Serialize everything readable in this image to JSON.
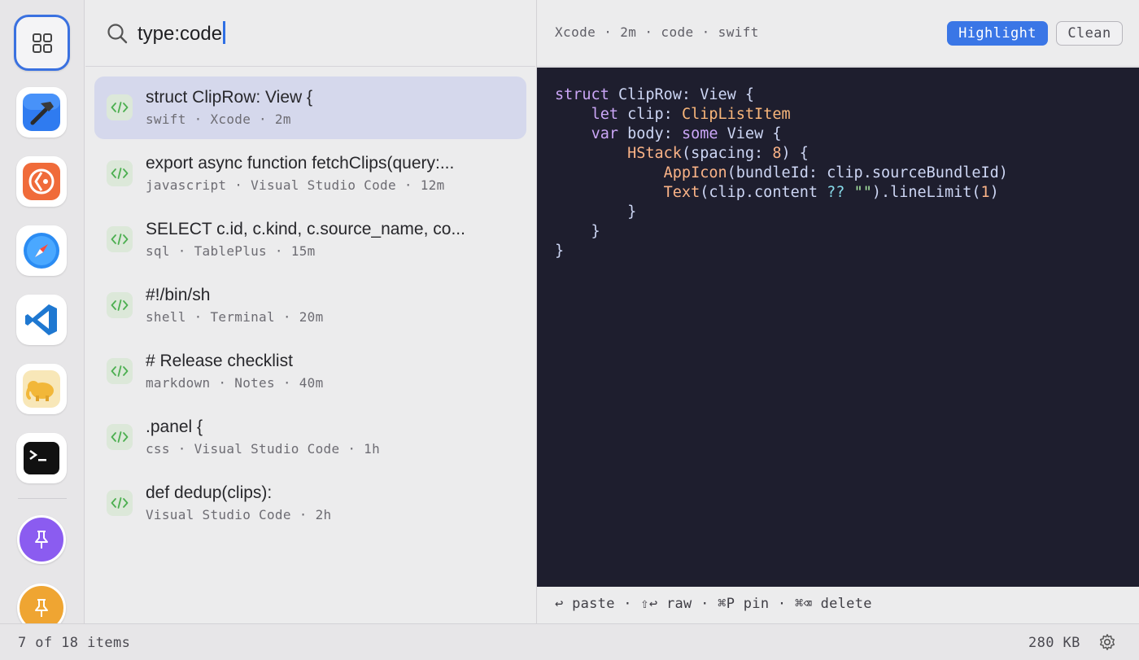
{
  "rail": {
    "items": [
      {
        "id": "all",
        "icon": "grid-icon",
        "selected": true
      },
      {
        "id": "xcode",
        "icon": "xcode-hammer-icon",
        "color": "#2f7bf0"
      },
      {
        "id": "git",
        "icon": "git-app-icon",
        "color": "#f06b3a"
      },
      {
        "id": "safari",
        "icon": "safari-compass-icon",
        "color": "#2b8cf3"
      },
      {
        "id": "vscode",
        "icon": "vscode-icon",
        "color": "#1f78d1"
      },
      {
        "id": "tableplus",
        "icon": "elephant-icon",
        "color": "#f2b739"
      },
      {
        "id": "terminal",
        "icon": "terminal-icon",
        "color": "#111111"
      }
    ],
    "pins": [
      {
        "icon": "pin-icon",
        "color": "#8b5cf0"
      },
      {
        "icon": "pin-icon",
        "color": "#efa532"
      }
    ]
  },
  "search": {
    "query": "type:code"
  },
  "clips": [
    {
      "title": "struct ClipRow: View {",
      "meta": "swift · Xcode · 2m",
      "selected": true
    },
    {
      "title": "export async function fetchClips(query:...",
      "meta": "javascript · Visual Studio Code · 12m"
    },
    {
      "title": "SELECT c.id, c.kind, c.source_name, co...",
      "meta": "sql · TablePlus · 15m"
    },
    {
      "title": "#!/bin/sh",
      "meta": "shell · Terminal · 20m"
    },
    {
      "title": "# Release checklist",
      "meta": "markdown · Notes · 40m"
    },
    {
      "title": ".panel {",
      "meta": "css · Visual Studio Code · 1h"
    },
    {
      "title": "def dedup(clips):",
      "meta": "Visual Studio Code · 2h"
    }
  ],
  "detail": {
    "meta": "Xcode · 2m · code · swift",
    "highlight_label": "Highlight",
    "clean_label": "Clean",
    "code_lines": [
      "struct ClipRow: View {",
      "    let clip: ClipListItem",
      "    var body: some View {",
      "        HStack(spacing: 8) {",
      "            AppIcon(bundleId: clip.sourceBundleId)",
      "            Text(clip.content ?? \"\").lineLimit(1)",
      "        }",
      "    }",
      "}"
    ],
    "shortcuts": "↩ paste · ⇧↩ raw · ⌘P pin · ⌘⌫ delete"
  },
  "status": {
    "count": "7 of 18 items",
    "size": "280 KB"
  },
  "colors": {
    "accent": "#3a76e6",
    "code_bg": "#1e1e2e",
    "selected_row": "#d5d8ec"
  }
}
